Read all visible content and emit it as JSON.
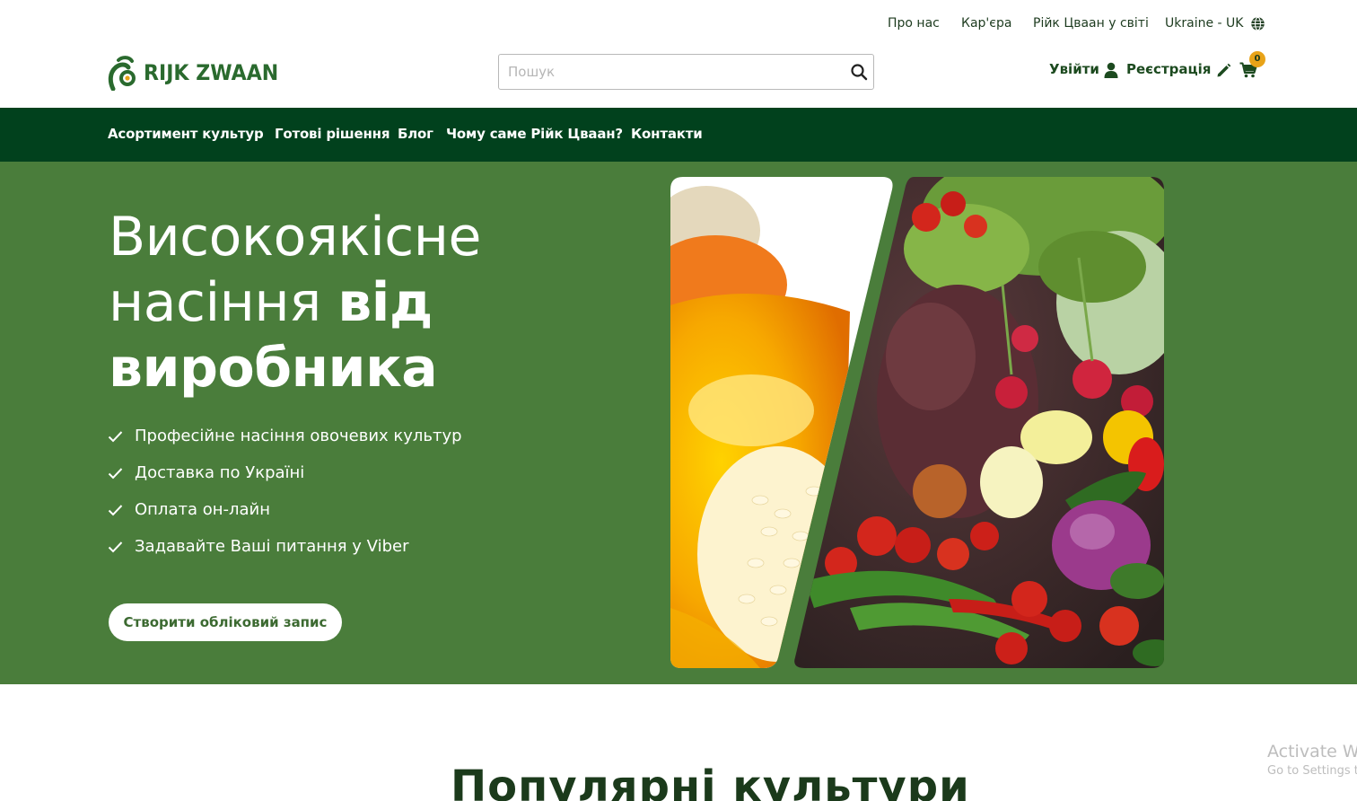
{
  "top_links": {
    "about": "Про нас",
    "careers": "Кар'єра",
    "worldwide": "Рійк Цваан у світі",
    "locale": "Ukraine - UK"
  },
  "header": {
    "logo_text": "RIJK ZWAAN",
    "search_placeholder": "Пошук",
    "login_label": "Увійти",
    "register_label": "Реєстрація",
    "cart_count": "0"
  },
  "nav": {
    "items": [
      {
        "label": "Асортимент культур"
      },
      {
        "label": "Готові рішення"
      },
      {
        "label": "Блог"
      },
      {
        "label": "Чому саме Рійк Цваан?"
      },
      {
        "label": "Контакти"
      }
    ]
  },
  "hero": {
    "title_line1": "Високоякісне",
    "title_line2_regular": "насіння ",
    "title_line2_bold": "від",
    "title_line3_bold": "виробника",
    "features": [
      {
        "text": "Професійне насіння овочевих культур"
      },
      {
        "text": "Доставка по Україні"
      },
      {
        "text": "Оплата он-лайн"
      },
      {
        "text": "Задавайте Ваші питання у Viber"
      }
    ],
    "cta_label": "Створити обліковий запис"
  },
  "section": {
    "popular_title": "Популярні культури"
  },
  "os_watermark": {
    "line1": "Activate Wi",
    "line2": "Go to Settings t"
  },
  "colors": {
    "brand_dark_green": "#01411d",
    "hero_green": "#4a7d3b",
    "logo_green": "#2a6a2e",
    "cart_badge": "#e8a318"
  },
  "icons": [
    "globe-icon",
    "search-icon",
    "user-icon",
    "pencil-icon",
    "cart-icon",
    "check-icon",
    "logo-icon"
  ]
}
